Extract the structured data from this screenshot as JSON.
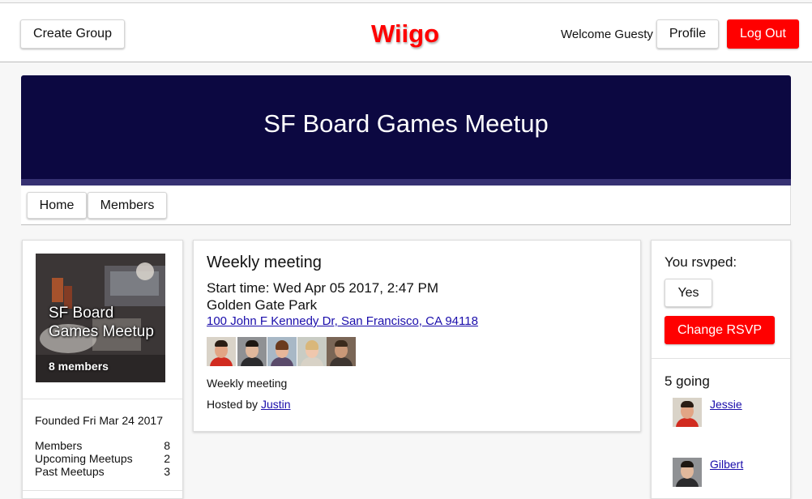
{
  "header": {
    "create_group_label": "Create Group",
    "brand": "Wiigo",
    "welcome_text": "Welcome Guesty",
    "profile_label": "Profile",
    "logout_label": "Log Out"
  },
  "group": {
    "title": "SF Board Games Meetup",
    "tabs": [
      "Home",
      "Members"
    ],
    "image_name": "SF Board Games Meetup",
    "image_members": "8 members",
    "founded": "Founded Fri Mar 24 2017",
    "stats": [
      {
        "label": "Members",
        "value": "8"
      },
      {
        "label": "Upcoming Meetups",
        "value": "2"
      },
      {
        "label": "Past Meetups",
        "value": "3"
      }
    ]
  },
  "event": {
    "title": "Weekly meeting",
    "start_time": "Start time: Wed Apr 05 2017, 2:47 PM",
    "location": "Golden Gate Park",
    "address": "100 John F Kennedy Dr, San Francisco, CA 94118",
    "description": "Weekly meeting",
    "hosted_by_label": "Hosted by",
    "host": "Justin"
  },
  "rsvp": {
    "heading": "You rsvped:",
    "answer": "Yes",
    "change_label": "Change RSVP",
    "going_count": "5 going",
    "attendees": [
      "Jessie",
      "Gilbert"
    ]
  },
  "colors": {
    "brand_red": "#ff0000",
    "banner_navy": "#0c0841",
    "banner_strip": "#363172",
    "link_blue": "#1a0dab"
  },
  "icons": {
    "attendee_avatars": [
      "avatar-red-shirt-man",
      "avatar-dark-hair-man",
      "avatar-woman-brown-hair",
      "avatar-woman-blonde",
      "avatar-bearded-man"
    ]
  }
}
